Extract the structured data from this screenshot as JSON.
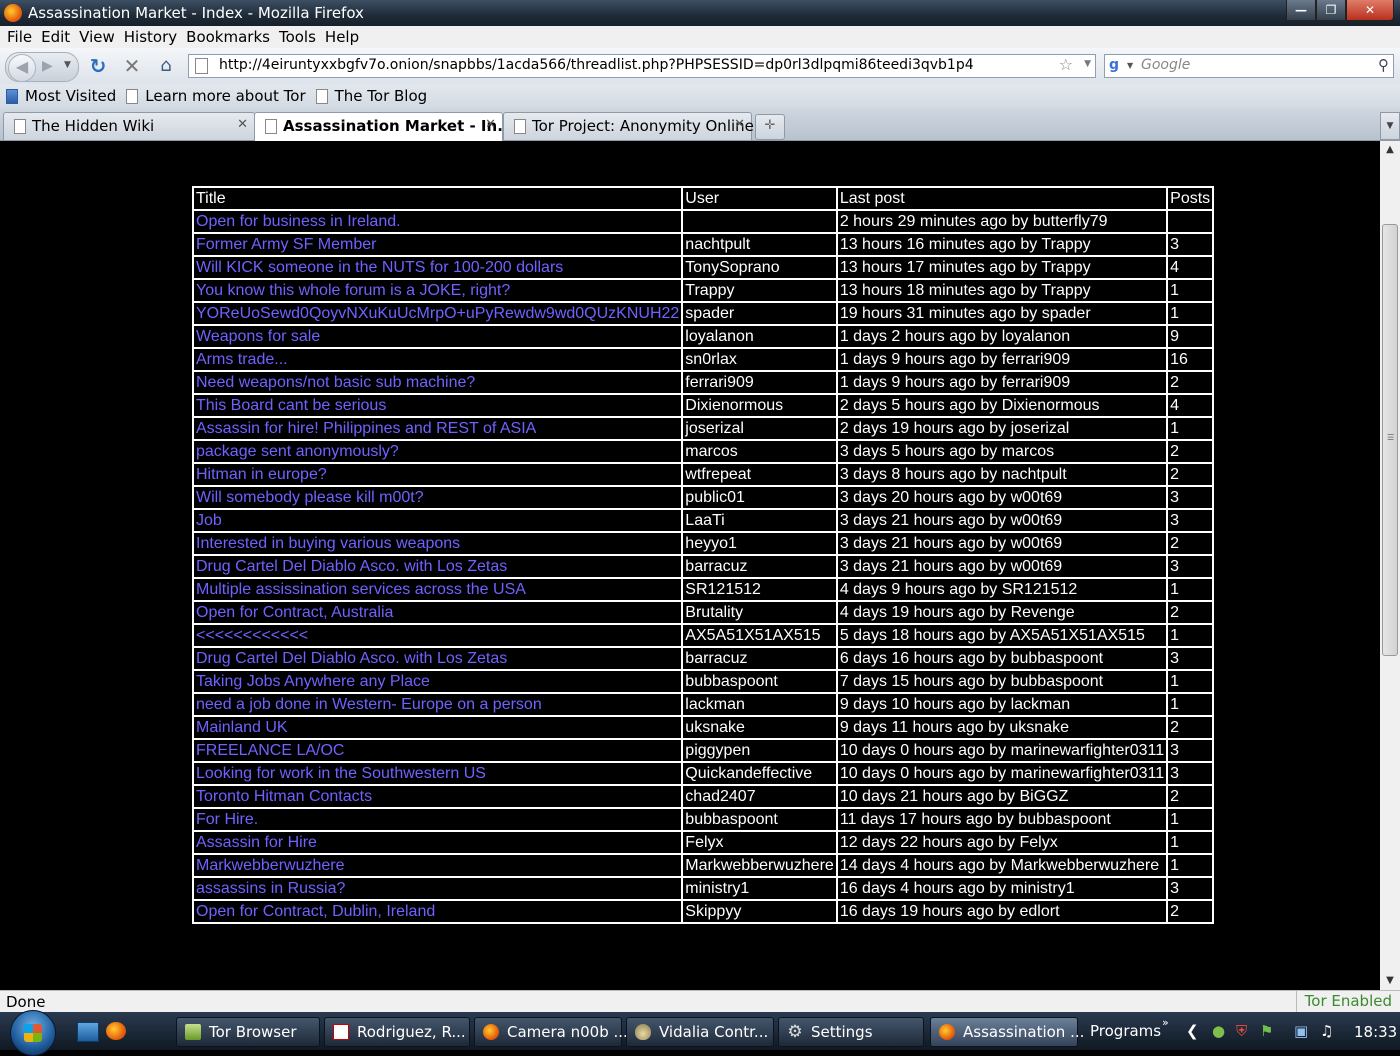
{
  "window": {
    "title": "Assassination Market - Index - Mozilla Firefox"
  },
  "menu": [
    "File",
    "Edit",
    "View",
    "History",
    "Bookmarks",
    "Tools",
    "Help"
  ],
  "address": {
    "url": "http://4eiruntyxxbgfv7o.onion/snapbbs/1acda566/threadlist.php?PHPSESSID=dp0rl3dlpqmi86teedi3qvb1p4",
    "search_placeholder": "Google"
  },
  "bookmarks": [
    "Most Visited",
    "Learn more about Tor",
    "The Tor Blog"
  ],
  "tabs": [
    {
      "label": "The Hidden Wiki",
      "active": false
    },
    {
      "label": "Assassination Market - In...",
      "active": true
    },
    {
      "label": "Tor Project: Anonymity Online",
      "active": false
    }
  ],
  "table": {
    "headers": [
      "Title",
      "User",
      "Last post",
      "Posts"
    ],
    "rows": [
      [
        "Open for business in Ireland.",
        "",
        "2 hours 29 minutes ago by butterfly79",
        ""
      ],
      [
        "Former Army SF Member",
        "nachtpult",
        "13 hours 16 minutes ago by Trappy",
        "3"
      ],
      [
        "Will KICK someone in the NUTS for 100-200 dollars",
        "TonySoprano",
        "13 hours 17 minutes ago by Trappy",
        "4"
      ],
      [
        "You know this whole forum is a JOKE, right?",
        "Trappy",
        "13 hours 18 minutes ago by Trappy",
        "1"
      ],
      [
        "YOReUoSewd0QoyvNXuKuUcMrpO+uPyRewdw9wd0QUzKNUH22",
        "spader",
        "19 hours 31 minutes ago by spader",
        "1"
      ],
      [
        "Weapons for sale",
        "loyalanon",
        "1 days 2 hours ago by loyalanon",
        "9"
      ],
      [
        "Arms trade...",
        "sn0rlax",
        "1 days 9 hours ago by ferrari909",
        "16"
      ],
      [
        "Need weapons/not basic sub machine?",
        "ferrari909",
        "1 days 9 hours ago by ferrari909",
        "2"
      ],
      [
        "This Board cant be serious",
        "Dixienormous",
        "2 days 5 hours ago by Dixienormous",
        "4"
      ],
      [
        "Assassin for hire! Philippines and REST of ASIA",
        "joserizal",
        "2 days 19 hours ago by joserizal",
        "1"
      ],
      [
        "package sent anonymously?",
        "marcos",
        "3 days 5 hours ago by marcos",
        "2"
      ],
      [
        "Hitman in europe?",
        "wtfrepeat",
        "3 days 8 hours ago by nachtpult",
        "2"
      ],
      [
        "Will somebody please kill m00t?",
        "public01",
        "3 days 20 hours ago by w00t69",
        "3"
      ],
      [
        "Job",
        "LaaTi",
        "3 days 21 hours ago by w00t69",
        "3"
      ],
      [
        "Interested in buying various weapons",
        "heyyo1",
        "3 days 21 hours ago by w00t69",
        "2"
      ],
      [
        "Drug Cartel Del Diablo Asco. with Los Zetas",
        "barracuz",
        "3 days 21 hours ago by w00t69",
        "3"
      ],
      [
        "Multiple assissination services across the USA",
        "SR121512",
        "4 days 9 hours ago by SR121512",
        "1"
      ],
      [
        "Open for Contract, Australia",
        "Brutality",
        "4 days 19 hours ago by Revenge",
        "2"
      ],
      [
        "<<<<<<<<<<<<",
        "AX5A51X51AX515",
        "5 days 18 hours ago by AX5A51X51AX515",
        "1"
      ],
      [
        "Drug Cartel Del Diablo Asco. with Los Zetas",
        "barracuz",
        "6 days 16 hours ago by bubbaspoont",
        "3"
      ],
      [
        "Taking Jobs Anywhere any Place",
        "bubbaspoont",
        "7 days 15 hours ago by bubbaspoont",
        "1"
      ],
      [
        "need a job done in Western- Europe on a person",
        "lackman",
        "9 days 10 hours ago by lackman",
        "1"
      ],
      [
        "Mainland UK",
        "uksnake",
        "9 days 11 hours ago by uksnake",
        "2"
      ],
      [
        "FREELANCE LA/OC",
        "piggypen",
        "10 days 0 hours ago by marinewarfighter0311",
        "3"
      ],
      [
        "Looking for work in the Southwestern US",
        "Quickandeffective",
        "10 days 0 hours ago by marinewarfighter0311",
        "3"
      ],
      [
        "Toronto Hitman Contacts",
        "chad2407",
        "10 days 21 hours ago by BiGGZ",
        "2"
      ],
      [
        "For Hire.",
        "bubbaspoont",
        "11 days 17 hours ago by bubbaspoont",
        "1"
      ],
      [
        "Assassin for Hire",
        "Felyx",
        "12 days 22 hours ago by Felyx",
        "1"
      ],
      [
        "Markwebberwuzhere",
        "Markwebberwuzhere",
        "14 days 4 hours ago by Markwebberwuzhere",
        "1"
      ],
      [
        "assassins in Russia?",
        "ministry1",
        "16 days 4 hours ago by ministry1",
        "3"
      ],
      [
        "Open for Contract, Dublin, Ireland",
        "Skippyy",
        "16 days 19 hours ago by edlort",
        "2"
      ]
    ]
  },
  "status": {
    "left": "Done",
    "right": "Tor Enabled"
  },
  "taskbar": {
    "buttons": [
      {
        "label": "Tor Browser",
        "icon": "tor-icon"
      },
      {
        "label": "Rodriguez, R...",
        "icon": "pdf-icon"
      },
      {
        "label": "Camera n00b ...",
        "icon": "firefox-icon"
      },
      {
        "label": "Vidalia Contr...",
        "icon": "onion-icon"
      },
      {
        "label": "Settings",
        "icon": "settings-icon"
      },
      {
        "label": "Assassination ...",
        "icon": "firefox-icon"
      }
    ],
    "programs": "Programs",
    "clock": "18:33"
  },
  "colors": {
    "link": "#6f62ff",
    "background": "#000000",
    "tor_enabled": "#3c8a2e"
  }
}
